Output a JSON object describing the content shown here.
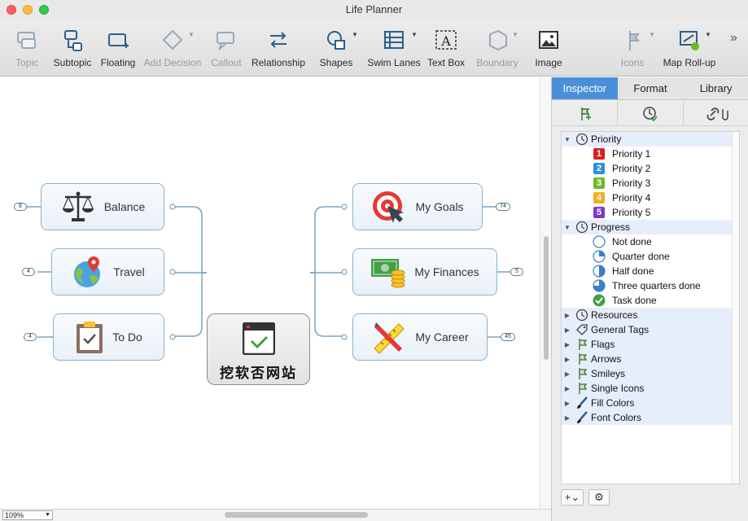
{
  "window": {
    "title": "Life Planner"
  },
  "toolbar": {
    "items": [
      {
        "label": "Topic",
        "enabled": false
      },
      {
        "label": "Subtopic",
        "enabled": true
      },
      {
        "label": "Floating",
        "enabled": true
      },
      {
        "label": "Add Decision",
        "enabled": false
      },
      {
        "label": "Callout",
        "enabled": false
      },
      {
        "label": "Relationship",
        "enabled": true
      },
      {
        "label": "Shapes",
        "enabled": true
      },
      {
        "label": "Swim Lanes",
        "enabled": true
      },
      {
        "label": "Text Box",
        "enabled": true
      },
      {
        "label": "Boundary",
        "enabled": false
      },
      {
        "label": "Image",
        "enabled": true
      },
      {
        "label": "Icons",
        "enabled": false
      },
      {
        "label": "Map Roll-up",
        "enabled": true
      }
    ],
    "overflow": "»"
  },
  "map": {
    "central": {
      "text": "挖软否网站"
    },
    "left_topics": [
      {
        "label": "Balance",
        "badge": "8",
        "icon": "scales-icon"
      },
      {
        "label": "Travel",
        "badge": "4",
        "icon": "globe-pin-icon"
      },
      {
        "label": "To Do",
        "badge": "4",
        "icon": "clipboard-icon"
      }
    ],
    "right_topics": [
      {
        "label": "My Goals",
        "badge": "74",
        "icon": "target-icon"
      },
      {
        "label": "My Finances",
        "badge": "5",
        "icon": "money-icon"
      },
      {
        "label": "My Career",
        "badge": "45",
        "icon": "tools-icon"
      }
    ]
  },
  "status": {
    "zoom": "109%"
  },
  "panel": {
    "tabs": [
      "Inspector",
      "Format",
      "Library"
    ],
    "active_tab": "Inspector",
    "groups": {
      "priority": {
        "label": "Priority",
        "items": [
          "Priority 1",
          "Priority 2",
          "Priority 3",
          "Priority 4",
          "Priority 5"
        ]
      },
      "progress": {
        "label": "Progress",
        "items": [
          "Not done",
          "Quarter done",
          "Half done",
          "Three quarters done",
          "Task done"
        ]
      },
      "collapsed": [
        "Resources",
        "General Tags",
        "Flags",
        "Arrows",
        "Smileys",
        "Single Icons",
        "Fill Colors",
        "Font Colors"
      ]
    },
    "priority_colors": [
      "#d9201e",
      "#2f8fe0",
      "#6cbc2a",
      "#f2b01e",
      "#7c3cc8"
    ],
    "accent": "#4a90d9"
  }
}
